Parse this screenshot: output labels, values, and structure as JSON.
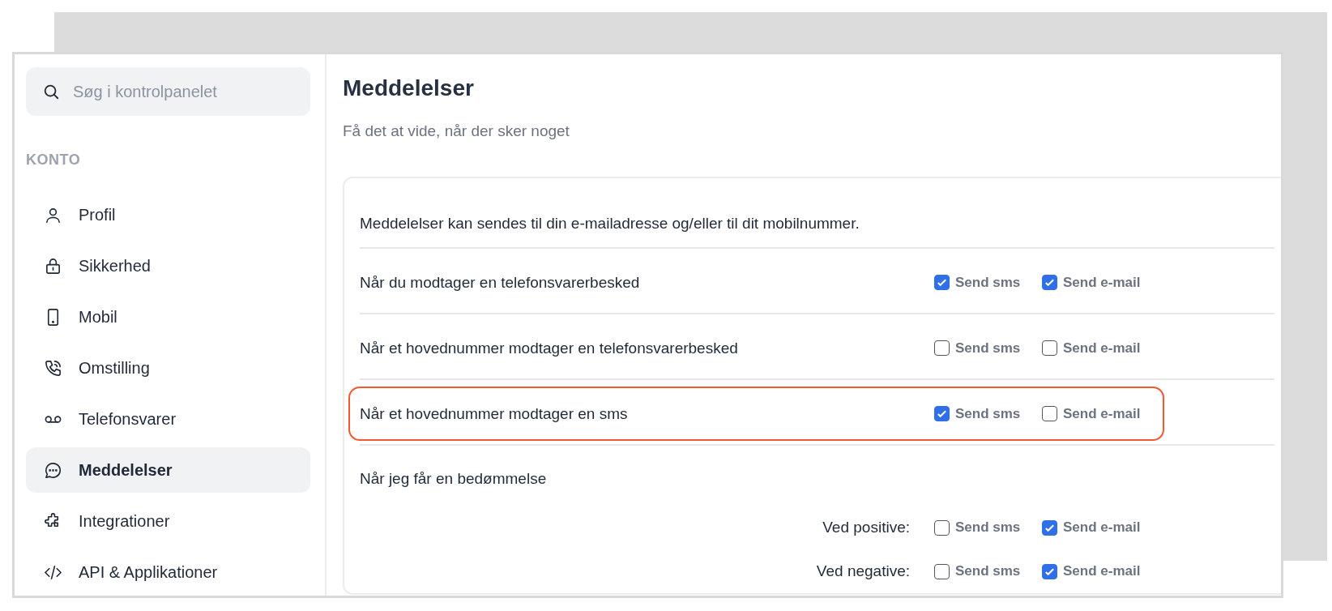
{
  "search": {
    "placeholder": "Søg i kontrolpanelet"
  },
  "sidebar": {
    "section": "KONTO",
    "items": [
      {
        "label": "Profil",
        "kind": "person",
        "selected": false
      },
      {
        "label": "Sikkerhed",
        "kind": "lock",
        "selected": false
      },
      {
        "label": "Mobil",
        "kind": "phone",
        "selected": false
      },
      {
        "label": "Omstilling",
        "kind": "call",
        "selected": false
      },
      {
        "label": "Telefonsvarer",
        "kind": "voicemail",
        "selected": false
      },
      {
        "label": "Meddelelser",
        "kind": "chat",
        "selected": true
      },
      {
        "label": "Integrationer",
        "kind": "puzzle",
        "selected": false
      },
      {
        "label": "API & Applikationer",
        "kind": "code",
        "selected": false
      }
    ]
  },
  "page": {
    "title": "Meddelelser",
    "subtitle": "Få det at vide, når der sker noget"
  },
  "card": {
    "intro": "Meddelelser kan sendes til din e-mailadresse og/eller til dit mobilnummer.",
    "rules": [
      {
        "kind": "row",
        "label": "Når du modtager en telefonsvarerbesked",
        "highlighted": false,
        "options": [
          {
            "label": "Send sms",
            "checked": true
          },
          {
            "label": "Send e-mail",
            "checked": true
          }
        ]
      },
      {
        "kind": "row",
        "label": "Når et hovednummer modtager en telefonsvarerbesked",
        "highlighted": false,
        "options": [
          {
            "label": "Send sms",
            "checked": false
          },
          {
            "label": "Send e-mail",
            "checked": false
          }
        ]
      },
      {
        "kind": "row",
        "label": "Når et hovednummer modtager en sms",
        "highlighted": true,
        "options": [
          {
            "label": "Send sms",
            "checked": true
          },
          {
            "label": "Send e-mail",
            "checked": false
          }
        ]
      },
      {
        "kind": "group",
        "label": "Når jeg får en bedømmelse",
        "children": [
          {
            "label": "Ved positive:",
            "options": [
              {
                "label": "Send sms",
                "checked": false
              },
              {
                "label": "Send e-mail",
                "checked": true
              }
            ]
          },
          {
            "label": "Ved negative:",
            "options": [
              {
                "label": "Send sms",
                "checked": false
              },
              {
                "label": "Send e-mail",
                "checked": true
              }
            ]
          }
        ]
      }
    ]
  }
}
